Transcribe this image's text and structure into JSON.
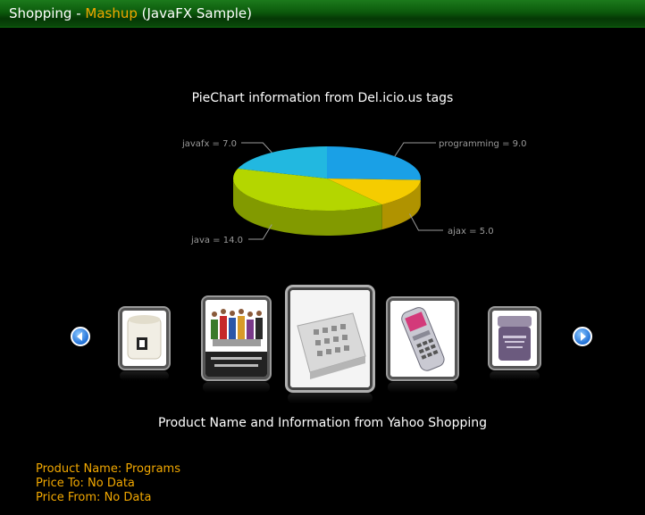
{
  "window": {
    "title_part1": "Shopping - ",
    "title_part2": "Mashup",
    "title_part3": " (JavaFX Sample)"
  },
  "chart_data": {
    "type": "pie",
    "title": "PieChart information from Del.icio.us tags",
    "slices": [
      {
        "label": "programming = 9.0",
        "value": 9.0,
        "color": "#1aa0e6"
      },
      {
        "label": "ajax = 5.0",
        "value": 5.0,
        "color": "#f5cc00"
      },
      {
        "label": "java = 14.0",
        "value": 14.0,
        "color": "#b4d600"
      },
      {
        "label": "javafx = 7.0",
        "value": 7.0,
        "color": "#22b8e0"
      }
    ]
  },
  "carousel": {
    "prev_icon": "chevron-left-icon",
    "next_icon": "chevron-right-icon",
    "items": [
      "jar-product",
      "apparel-book-product",
      "mixing-console-product",
      "mobile-phone-product",
      "cosmetic-jar-product"
    ],
    "selected_index": 2
  },
  "product": {
    "section_title": "Product Name and Information from Yahoo Shopping",
    "name_line": "Product Name: Programs",
    "price_to_line": "Price To:  No Data",
    "price_from_line": "Price From:   No Data"
  },
  "colors": {
    "accent": "#f2a800",
    "titlebar": "#0c5a0c"
  }
}
